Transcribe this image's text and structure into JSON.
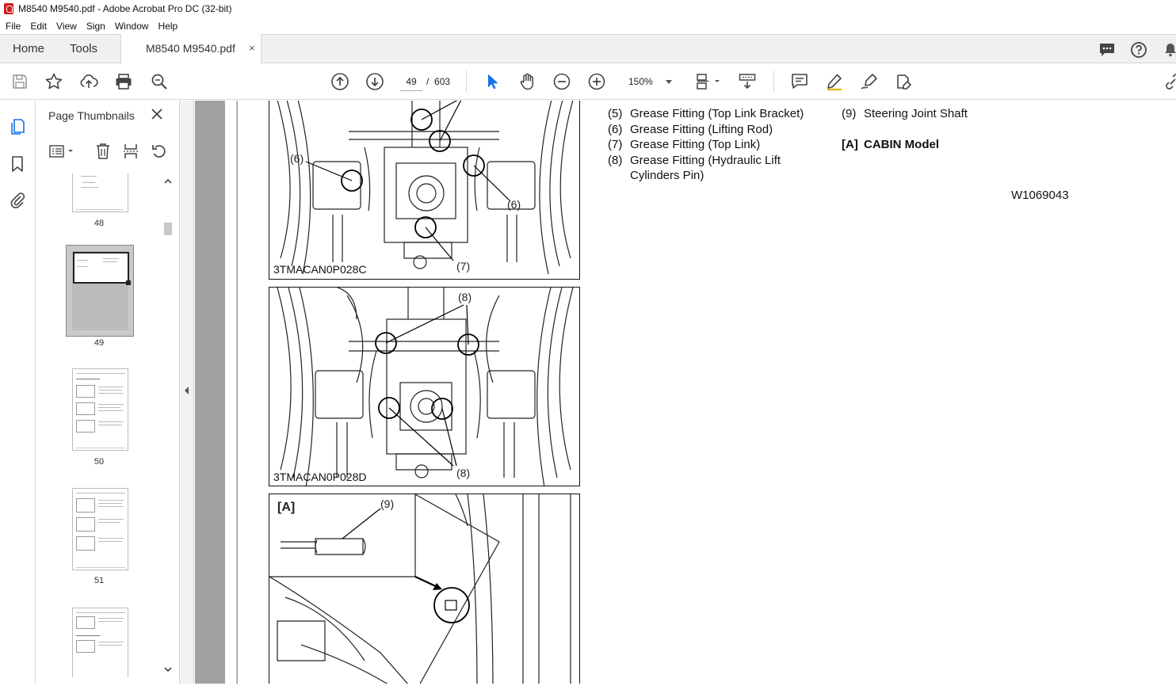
{
  "window": {
    "title": "M8540 M9540.pdf - Adobe Acrobat Pro DC (32-bit)"
  },
  "menu": [
    "File",
    "Edit",
    "View",
    "Sign",
    "Window",
    "Help"
  ],
  "tabs": {
    "home": "Home",
    "tools": "Tools",
    "document": "M8540 M9540.pdf",
    "close": "×"
  },
  "toolbar": {
    "page_current": "49",
    "page_sep": "/",
    "page_total": "603",
    "zoom": "150%"
  },
  "panel": {
    "title": "Page Thumbnails",
    "thumbnails": [
      {
        "label": "48"
      },
      {
        "label": "49",
        "selected": true
      },
      {
        "label": "50"
      },
      {
        "label": "51"
      },
      {
        "label": ""
      }
    ]
  },
  "document": {
    "figures": [
      {
        "caption": "3TMACAN0P028C",
        "callouts": [
          "(6)",
          "(6)",
          "(7)"
        ]
      },
      {
        "caption": "3TMACAN0P028D",
        "callouts": [
          "(8)",
          "(8)"
        ]
      },
      {
        "caption": "",
        "inset_label": "[A]",
        "callouts": [
          "(9)"
        ]
      }
    ],
    "items_left": [
      {
        "num": "(5)",
        "text": "Grease Fitting (Top Link Bracket)"
      },
      {
        "num": "(6)",
        "text": "Grease Fitting (Lifting Rod)"
      },
      {
        "num": "(7)",
        "text": "Grease Fitting (Top Link)"
      },
      {
        "num": "(8)",
        "text": "Grease Fitting (Hydraulic Lift"
      },
      {
        "num": "",
        "text": "Cylinders Pin)"
      }
    ],
    "items_right": [
      {
        "num": "(9)",
        "text": "Steering Joint Shaft"
      }
    ],
    "model_label": {
      "num": "[A]",
      "text": "CABIN Model"
    },
    "ref_code": "W1069043"
  }
}
